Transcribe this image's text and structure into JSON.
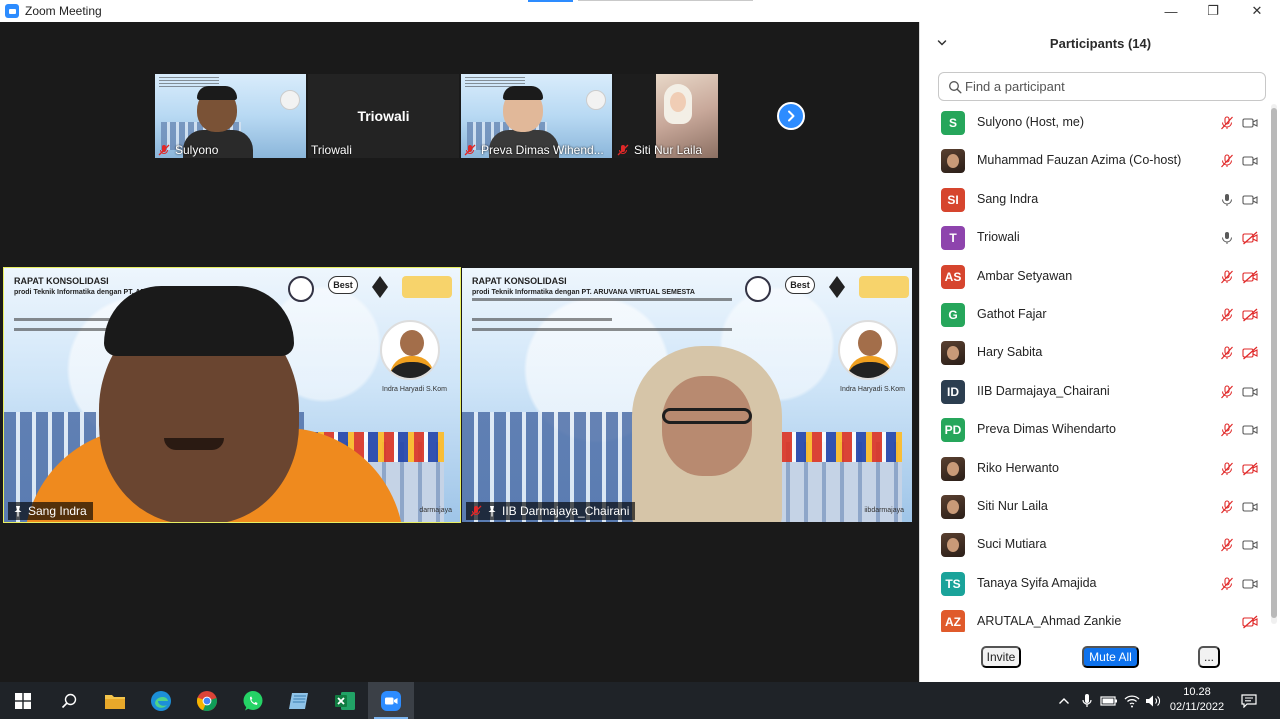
{
  "window": {
    "title": "Zoom Meeting",
    "minimize_glyph": "—",
    "restore_glyph": "❐",
    "close_glyph": "✕"
  },
  "gallery": {
    "thumbnails": [
      {
        "name": "Sulyono",
        "muted": true,
        "video": true
      },
      {
        "name": "Triowali",
        "big_name": "Triowali",
        "muted": false,
        "video": false
      },
      {
        "name": "Preva Dimas Wihend...",
        "muted": true,
        "video": true
      },
      {
        "name": "Siti Nur Laila",
        "muted": true,
        "video": true
      }
    ],
    "next_icon": "chevron-right-icon"
  },
  "main_tiles": [
    {
      "name": "Sang Indra",
      "pinned": true,
      "muted": false,
      "speaking": true,
      "slide_title_1": "RAPAT KONSOLIDASI",
      "slide_title_2": "prodi Teknik Informatika dengan PT. ARUVANA VIRTUAL",
      "slide_best": "Best",
      "presenter_name": "Indra Haryadi S.Kom",
      "watermark": "darmajaya"
    },
    {
      "name": "IIB Darmajaya_Chairani",
      "pinned": true,
      "muted": true,
      "speaking": false,
      "slide_title_1": "RAPAT KONSOLIDASI",
      "slide_title_2": "prodi Teknik Informatika dengan PT. ARUVANA VIRTUAL SEMESTA",
      "slide_best": "Best",
      "presenter_name": "Indra Haryadi S.Kom",
      "watermark": "iibdarmajaya"
    }
  ],
  "participants_panel": {
    "title": "Participants (14)",
    "search_placeholder": "Find a participant",
    "participants": [
      {
        "name": "Sulyono (Host, me)",
        "initials": "S",
        "avatar_color": "#26a65b",
        "photo": false,
        "mic": "muted",
        "cam": "on"
      },
      {
        "name": "Muhammad Fauzan Azima (Co-host)",
        "initials": "",
        "avatar_color": "#3a3a6a",
        "photo": true,
        "mic": "muted",
        "cam": "on"
      },
      {
        "name": "Sang Indra",
        "initials": "SI",
        "avatar_color": "#d6452e",
        "photo": false,
        "mic": "on",
        "cam": "on"
      },
      {
        "name": "Triowali",
        "initials": "T",
        "avatar_color": "#8e44ad",
        "photo": false,
        "mic": "on",
        "cam": "off"
      },
      {
        "name": "Ambar Setyawan",
        "initials": "AS",
        "avatar_color": "#d6452e",
        "photo": false,
        "mic": "muted",
        "cam": "off"
      },
      {
        "name": "Gathot Fajar",
        "initials": "G",
        "avatar_color": "#26a65b",
        "photo": false,
        "mic": "muted",
        "cam": "off"
      },
      {
        "name": "Hary Sabita",
        "initials": "",
        "avatar_color": "#3b2a22",
        "photo": true,
        "mic": "muted",
        "cam": "off"
      },
      {
        "name": "IIB Darmajaya_Chairani",
        "initials": "ID",
        "avatar_color": "#2c3e50",
        "photo": false,
        "mic": "muted",
        "cam": "on"
      },
      {
        "name": "Preva Dimas Wihendarto",
        "initials": "PD",
        "avatar_color": "#26a65b",
        "photo": false,
        "mic": "muted",
        "cam": "on"
      },
      {
        "name": "Riko Herwanto",
        "initials": "",
        "avatar_color": "#7a5236",
        "photo": true,
        "mic": "muted",
        "cam": "off"
      },
      {
        "name": "Siti Nur Laila",
        "initials": "",
        "avatar_color": "#d9b8a8",
        "photo": true,
        "mic": "muted",
        "cam": "on"
      },
      {
        "name": "Suci Mutiara",
        "initials": "",
        "avatar_color": "#5a3e30",
        "photo": true,
        "mic": "muted",
        "cam": "on"
      },
      {
        "name": "Tanaya Syifa Amajida",
        "initials": "TS",
        "avatar_color": "#1aa39a",
        "photo": false,
        "mic": "muted",
        "cam": "on"
      },
      {
        "name": "ARUTALA_Ahmad Zankie",
        "initials": "AZ",
        "avatar_color": "#e05a2b",
        "photo": false,
        "mic": "none",
        "cam": "off"
      }
    ],
    "invite_label": "Invite",
    "mute_all_label": "Mute All",
    "more_label": "..."
  },
  "taskbar": {
    "apps": [
      "windows-start-icon",
      "search-icon",
      "file-explorer-icon",
      "edge-icon",
      "chrome-icon",
      "whatsapp-icon",
      "notes-icon",
      "excel-icon",
      "zoom-icon"
    ],
    "time": "10.28",
    "date": "02/11/2022"
  },
  "colors": {
    "zoom_blue": "#2D8CFF",
    "mute_all_blue": "#0e72ed",
    "muted_red": "#e02828",
    "speaker_highlight": "#e8ef62",
    "taskbar_bg": "#1f2328"
  }
}
